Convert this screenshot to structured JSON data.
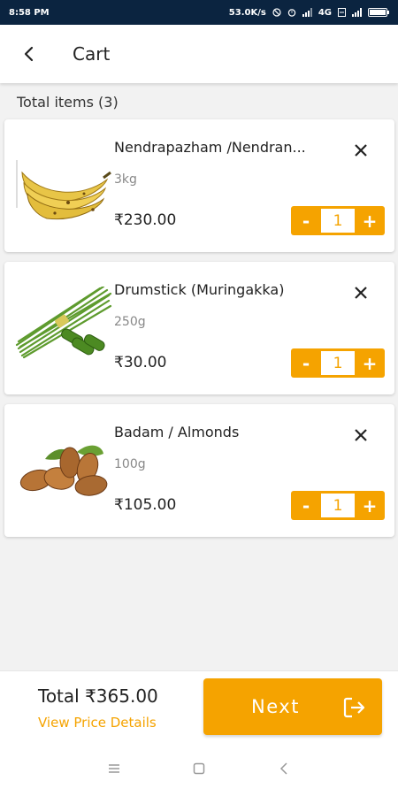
{
  "status_bar": {
    "time": "8:58 PM",
    "speed": "53.0K/s",
    "network": "4G",
    "icons": [
      "no-disturb-icon",
      "alarm-icon",
      "signal-icon",
      "volte-icon",
      "signal-icon",
      "battery-icon"
    ]
  },
  "header": {
    "title": "Cart",
    "back_icon": "back-arrow-icon"
  },
  "cart": {
    "total_items_label": "Total items (3)",
    "items": [
      {
        "name": "Nendrapazham /Nendran...",
        "quantity": "3kg",
        "price": "₹230.00",
        "count": "1",
        "image": "banana-image"
      },
      {
        "name": "Drumstick (Muringakka)",
        "quantity": "250g",
        "price": "₹30.00",
        "count": "1",
        "image": "drumstick-image"
      },
      {
        "name": "Badam / Almonds",
        "quantity": "100g",
        "price": "₹105.00",
        "count": "1",
        "image": "almonds-image"
      }
    ],
    "minus_label": "-",
    "plus_label": "+"
  },
  "footer": {
    "total_label": "Total",
    "total_value": "₹365.00",
    "view_details": "View Price Details",
    "next_label": "Next"
  },
  "colors": {
    "accent": "#f5a300",
    "status_bar": "#0b2440"
  }
}
